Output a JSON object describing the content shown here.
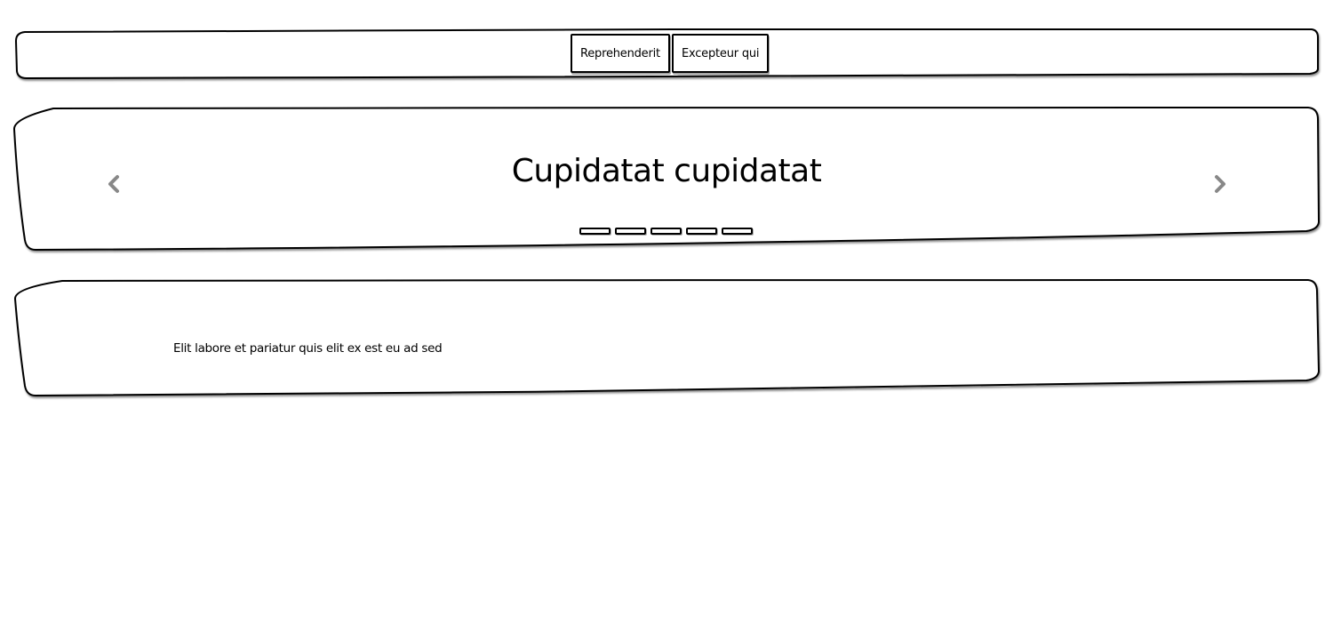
{
  "navbar": {
    "buttons": [
      {
        "label": "Reprehenderit"
      },
      {
        "label": "Excepteur qui"
      }
    ]
  },
  "carousel": {
    "title": "Cupidatat cupidatat",
    "prev_icon": "chevron-left-icon",
    "next_icon": "chevron-right-icon",
    "indicator_count": 5
  },
  "content": {
    "text": "Elit labore et pariatur quis elit ex est eu ad sed"
  },
  "colors": {
    "border": "#000000",
    "background": "#ffffff",
    "arrow": "#888888"
  }
}
